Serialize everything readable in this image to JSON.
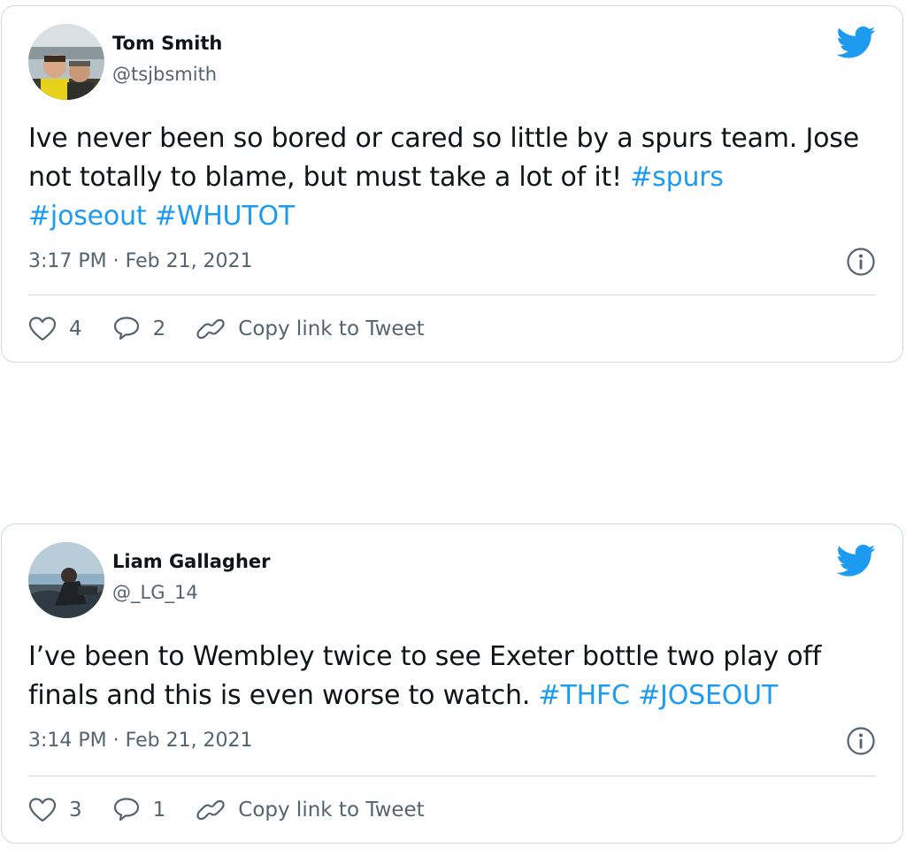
{
  "tweets": [
    {
      "author_name": "Tom Smith",
      "handle": "@tsjbsmith",
      "text_plain": "Ive never been so bored or cared so little by a spurs team. Jose not totally to blame, but must take a lot of it! ",
      "hashtags": [
        "#spurs",
        "#joseout",
        "#WHUTOT"
      ],
      "timestamp": "3:17 PM · Feb 21, 2021",
      "likes": "4",
      "replies": "2",
      "copy_link_label": "Copy link to Tweet"
    },
    {
      "author_name": "Liam Gallagher",
      "handle": "@_LG_14",
      "text_plain": "I’ve been to Wembley twice to see Exeter bottle two play off finals and this is even worse to watch. ",
      "hashtags": [
        "#THFC",
        "#JOSEOUT"
      ],
      "timestamp": "3:14 PM · Feb 21, 2021",
      "likes": "3",
      "replies": "1",
      "copy_link_label": "Copy link to Tweet"
    }
  ],
  "colors": {
    "twitter_blue": "#1d9bf0",
    "text": "#0f1419",
    "secondary": "#536471",
    "border": "#cfd9de"
  },
  "icons": [
    "twitter-bird-icon",
    "info-icon",
    "heart-icon",
    "reply-icon",
    "link-icon"
  ]
}
